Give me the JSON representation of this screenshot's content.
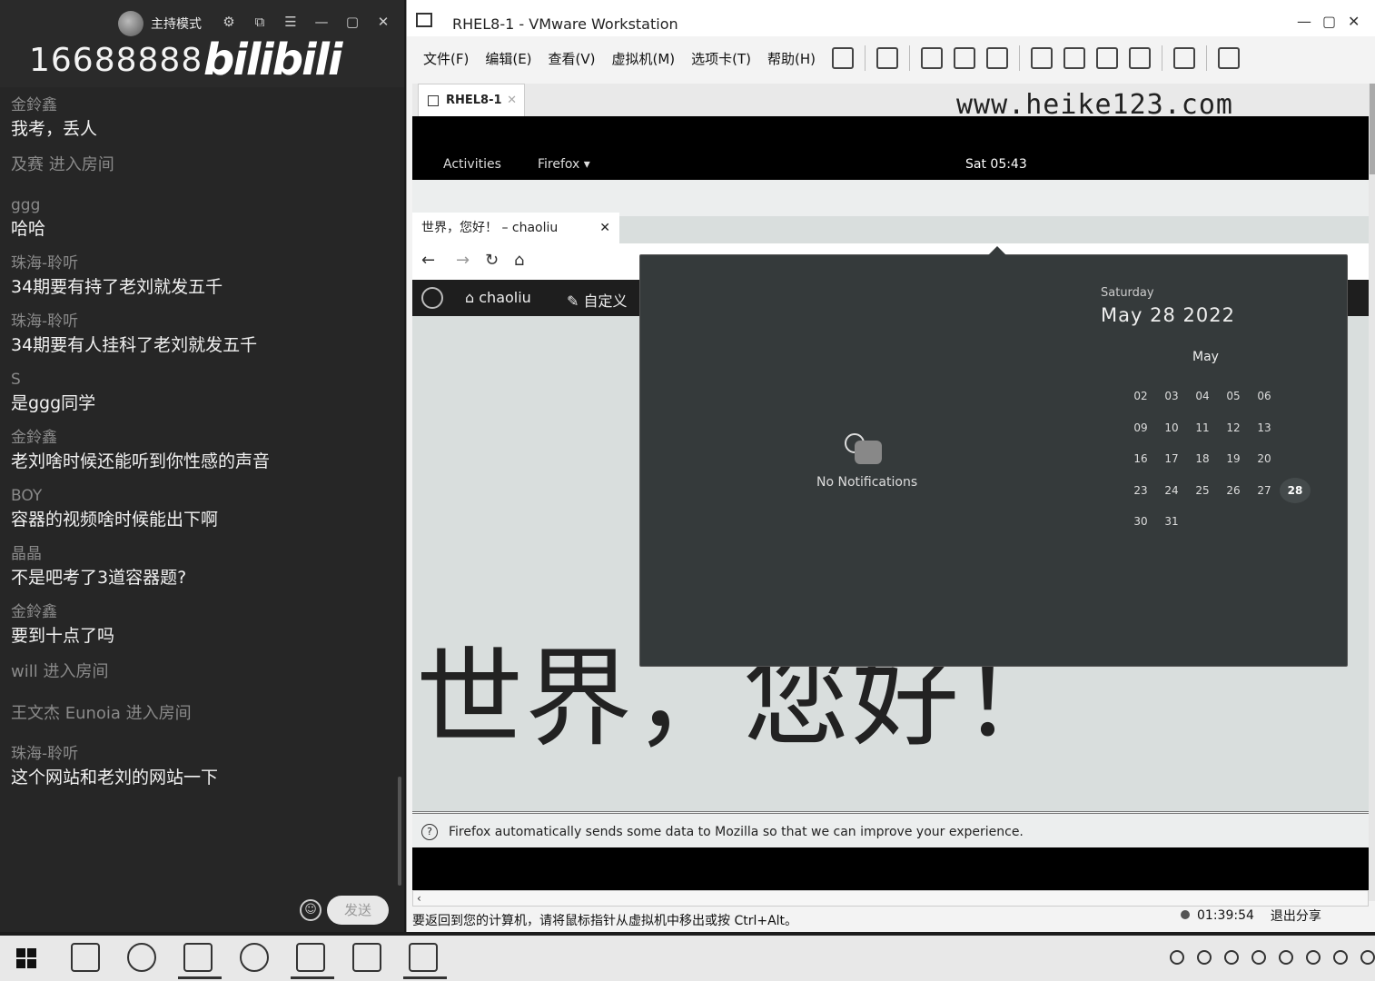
{
  "chat": {
    "host_label": "主持模式",
    "room_number": "16688888",
    "brand": "bilibili",
    "messages": [
      {
        "name": "金鈴鑫",
        "text": "我考，丢人"
      },
      {
        "system": "及赛 进入房间"
      },
      {
        "name": "ggg",
        "text": "哈哈"
      },
      {
        "name": "珠海-聆听",
        "text": "34期要有持了老刘就发五千"
      },
      {
        "name": "珠海-聆听",
        "text": "34期要有人挂科了老刘就发五千"
      },
      {
        "name": "S",
        "text": "是ggg同学"
      },
      {
        "name": "金鈴鑫",
        "text": "老刘啥时候还能听到你性感的声音"
      },
      {
        "name": "BOY",
        "text": "容器的视频啥时候能出下啊"
      },
      {
        "name": "晶晶",
        "text": "不是吧考了3道容器题?"
      },
      {
        "name": "金鈴鑫",
        "text": "要到十点了吗"
      },
      {
        "system": "will 进入房间"
      },
      {
        "system": "王文杰 Eunoia 进入房间"
      },
      {
        "name": "珠海-聆听",
        "text": "这个网站和老刘的网站一下"
      }
    ],
    "send_label": "发送"
  },
  "vmware": {
    "title": "RHEL8-1 - VMware Workstation",
    "menu": [
      "文件(F)",
      "编辑(E)",
      "查看(V)",
      "虚拟机(M)",
      "选项卡(T)",
      "帮助(H)"
    ],
    "tab_label": "RHEL8-1",
    "watermark": "www.heike123.com",
    "status_hint": "要返回到您的计算机，请将鼠标指针从虚拟机中移出或按 Ctrl+Alt。"
  },
  "gnome": {
    "activities": "Activities",
    "app_menu": "Firefox",
    "clock": "Sat 05:43"
  },
  "firefox": {
    "tab_title": "世界，您好！ – chaoliu",
    "site_name": "chaoliu",
    "customize": "自定义",
    "heading": "世界，您好！",
    "notice": "Firefox automatically sends some data to Mozilla so that we can improve your experience."
  },
  "calendar": {
    "no_notifications": "No Notifications",
    "weekday": "Saturday",
    "date": "May 28 2022",
    "month": "May",
    "weeks": [
      [
        "",
        "02",
        "03",
        "04",
        "05",
        "06",
        ""
      ],
      [
        "",
        "09",
        "10",
        "11",
        "12",
        "13",
        ""
      ],
      [
        "",
        "16",
        "17",
        "18",
        "19",
        "20",
        ""
      ],
      [
        "",
        "23",
        "24",
        "25",
        "26",
        "27",
        "28"
      ],
      [
        "",
        "30",
        "31",
        "",
        "",
        "",
        ""
      ]
    ],
    "selected": "28"
  },
  "share": {
    "timer": "01:39:54",
    "exit_label": "退出分享"
  }
}
